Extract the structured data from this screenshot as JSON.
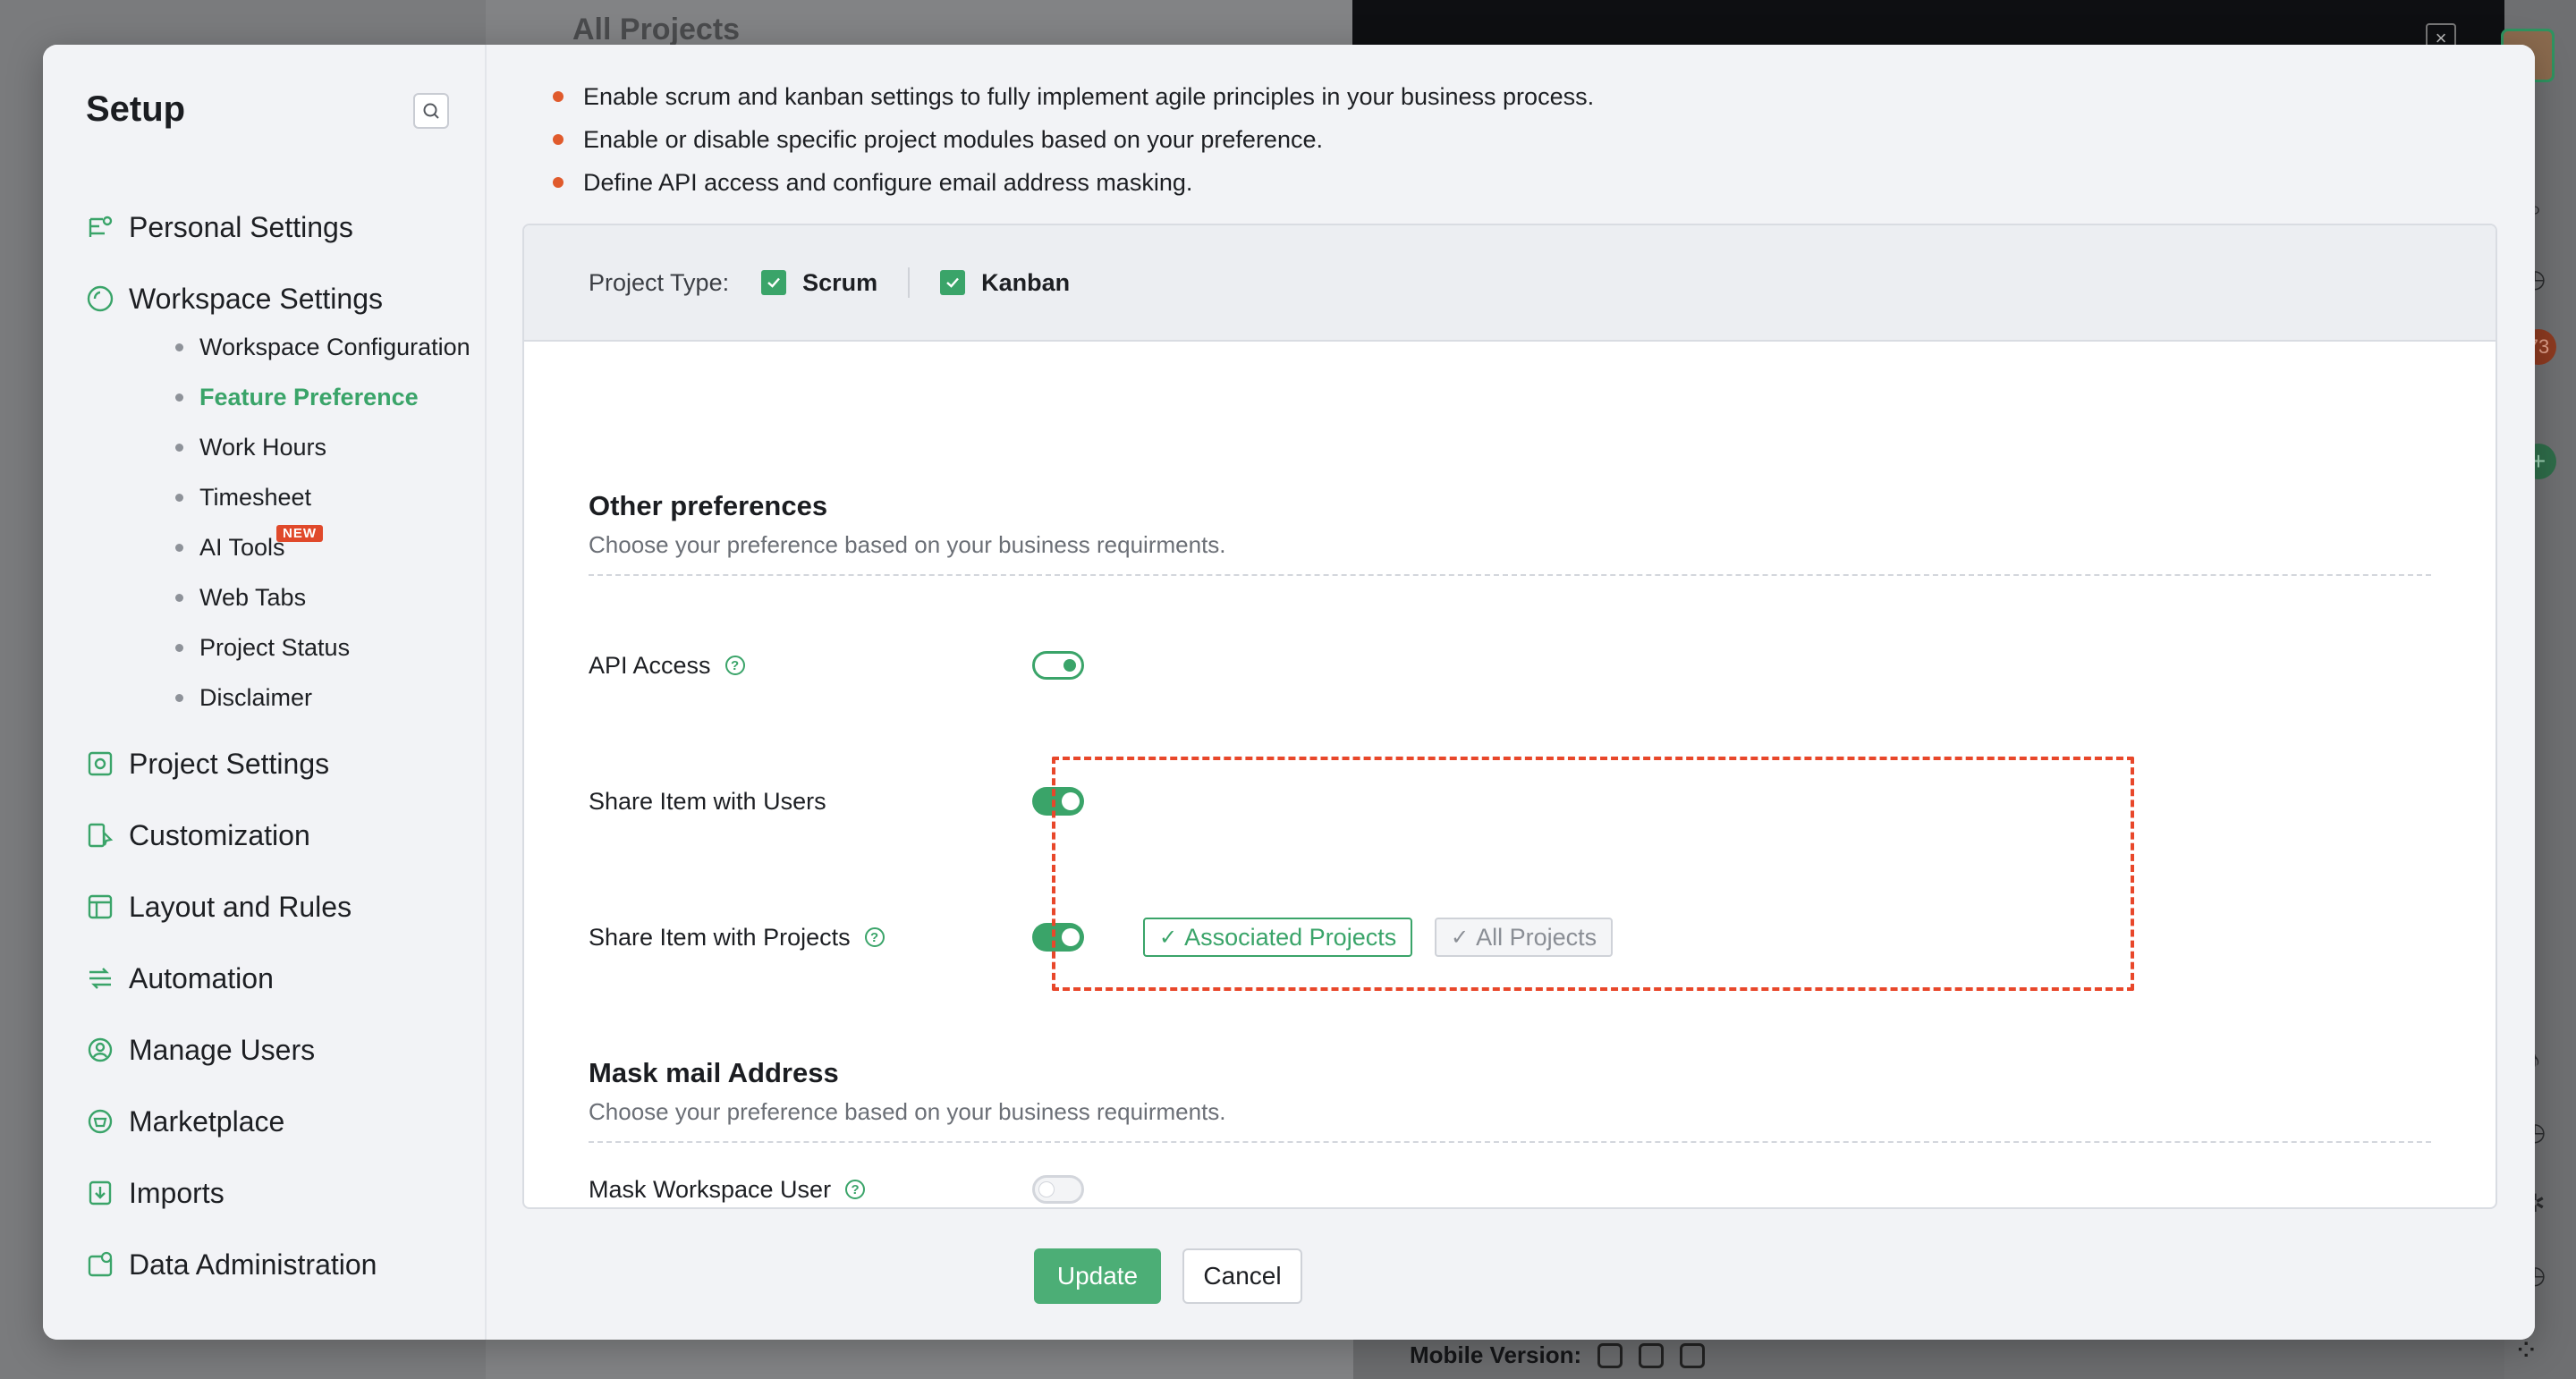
{
  "background": {
    "page_title": "All Projects",
    "mobile_label": "Mobile Version:",
    "badge_count": "73"
  },
  "sidebar": {
    "title": "Setup",
    "items": [
      {
        "label": "Personal Settings",
        "icon": "personal-settings-icon"
      },
      {
        "label": "Workspace Settings",
        "icon": "workspace-settings-icon"
      },
      {
        "label": "Project Settings",
        "icon": "project-settings-icon"
      },
      {
        "label": "Customization",
        "icon": "customization-icon"
      },
      {
        "label": "Layout and Rules",
        "icon": "layout-icon"
      },
      {
        "label": "Automation",
        "icon": "automation-icon"
      },
      {
        "label": "Manage Users",
        "icon": "manage-users-icon"
      },
      {
        "label": "Marketplace",
        "icon": "marketplace-icon"
      },
      {
        "label": "Imports",
        "icon": "imports-icon"
      },
      {
        "label": "Data Administration",
        "icon": "data-admin-icon"
      }
    ],
    "workspace_sub": [
      {
        "label": "Workspace Configuration"
      },
      {
        "label": "Feature Preference",
        "active": true
      },
      {
        "label": "Work Hours"
      },
      {
        "label": "Timesheet"
      },
      {
        "label": "AI Tools",
        "badge": "NEW"
      },
      {
        "label": "Web Tabs"
      },
      {
        "label": "Project Status"
      },
      {
        "label": "Disclaimer"
      }
    ]
  },
  "main": {
    "bullets": [
      "Enable scrum and kanban settings to fully implement agile principles in your business process.",
      "Enable or disable specific project modules based on your preference.",
      "Define API access and configure email address masking."
    ],
    "project_type": {
      "label": "Project Type:",
      "options": [
        {
          "label": "Scrum",
          "checked": true
        },
        {
          "label": "Kanban",
          "checked": true
        }
      ]
    },
    "other_prefs": {
      "title": "Other preferences",
      "desc": "Choose your preference based on your business requirments."
    },
    "api_access": {
      "label": "API Access",
      "state": "on"
    },
    "share_users": {
      "label": "Share Item with Users",
      "state": "on"
    },
    "share_projects": {
      "label": "Share Item with Projects",
      "state": "on",
      "chips": [
        {
          "label": "Associated Projects",
          "selected": true
        },
        {
          "label": "All Projects",
          "selected": false
        }
      ]
    },
    "mask_mail": {
      "title": "Mask mail Address",
      "desc": "Choose your preference based on your business requirments."
    },
    "mask_user": {
      "label": "Mask Workspace User",
      "state": "off"
    }
  },
  "footer": {
    "update_label": "Update",
    "cancel_label": "Cancel"
  },
  "colors": {
    "accent": "#3aa469",
    "highlight": "#e8472a",
    "bullet": "#e05a2c"
  }
}
